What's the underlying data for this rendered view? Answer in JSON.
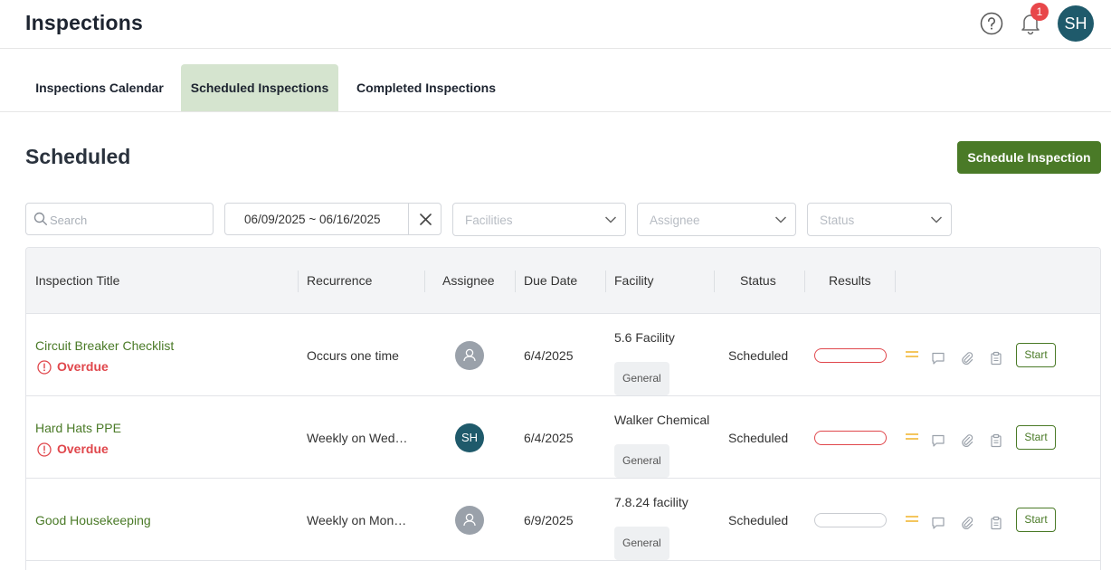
{
  "header": {
    "title": "Inspections",
    "help_icon": "question-circle-icon",
    "bell_icon": "bell-icon",
    "notification_count": "1",
    "user_initials": "SH"
  },
  "tabs": [
    {
      "label": "Inspections Calendar",
      "active": false
    },
    {
      "label": "Scheduled Inspections",
      "active": true
    },
    {
      "label": "Completed Inspections",
      "active": false
    }
  ],
  "section": {
    "title": "Scheduled",
    "schedule_button": "Schedule Inspection"
  },
  "filters": {
    "search_placeholder": "Search",
    "date_range": "06/09/2025 ~ 06/16/2025",
    "facilities_placeholder": "Facilities",
    "assignee_placeholder": "Assignee",
    "status_placeholder": "Status"
  },
  "table": {
    "columns": [
      "Inspection Title",
      "Recurrence",
      "Assignee",
      "Due Date",
      "Facility",
      "Status",
      "Results"
    ],
    "rows": [
      {
        "title": "Circuit Breaker Checklist",
        "overdue_label": "Overdue",
        "recurrence": "Occurs one time",
        "assignee": "",
        "due_date": "6/4/2025",
        "facility": "5.6 Facility",
        "facility_tag": "General",
        "status": "Scheduled",
        "start_label": "Start"
      },
      {
        "title": "Hard Hats PPE",
        "overdue_label": "Overdue",
        "recurrence": "Weekly on Wed…",
        "assignee": "SH",
        "due_date": "6/4/2025",
        "facility": "Walker Chemical",
        "facility_tag": "General",
        "status": "Scheduled",
        "start_label": "Start"
      },
      {
        "title": "Good Housekeeping",
        "overdue_label": "",
        "recurrence": "Weekly on Mon…",
        "assignee": "",
        "due_date": "6/9/2025",
        "facility": "7.8.24 facility",
        "facility_tag": "General",
        "status": "Scheduled",
        "start_label": "Start"
      }
    ]
  },
  "colors": {
    "primary": "#4a7a27",
    "active_tab": "#d5e4cf",
    "overdue": "#e0474c",
    "avatar": "#1f5a6b",
    "priority_medium": "#f0b429"
  }
}
